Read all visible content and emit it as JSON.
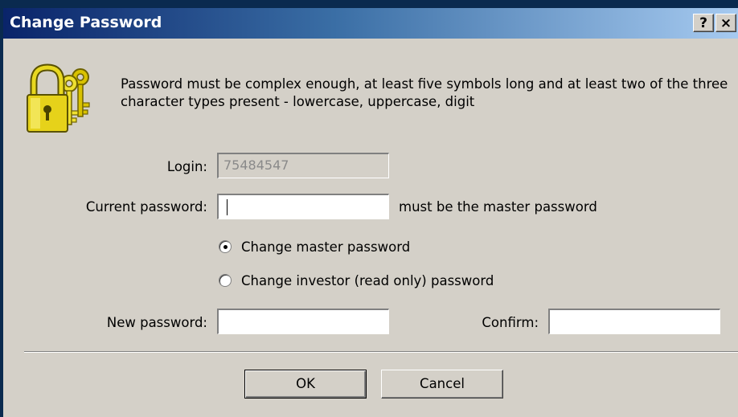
{
  "window": {
    "title": "Change Password",
    "help_button": "?",
    "close_button": "×"
  },
  "dialog": {
    "icon": "keys-lock-icon",
    "info_text": "Password must be complex enough, at least five symbols long and at least two of the three character types present - lowercase, uppercase, digit",
    "login": {
      "label": "Login:",
      "value": "75484547",
      "disabled": true
    },
    "current_password": {
      "label": "Current password:",
      "value": "",
      "hint": "must be the master password"
    },
    "radio_options": [
      {
        "label": "Change master password",
        "selected": true
      },
      {
        "label": "Change investor (read only) password",
        "selected": false
      }
    ],
    "new_password": {
      "label": "New password:",
      "value": ""
    },
    "confirm": {
      "label": "Confirm:",
      "value": ""
    },
    "buttons": {
      "ok": "OK",
      "cancel": "Cancel"
    }
  },
  "colors": {
    "face": "#d4d0c8",
    "title_start": "#0a246a",
    "title_end": "#a6caf0",
    "icon_gold": "#e0c400"
  }
}
